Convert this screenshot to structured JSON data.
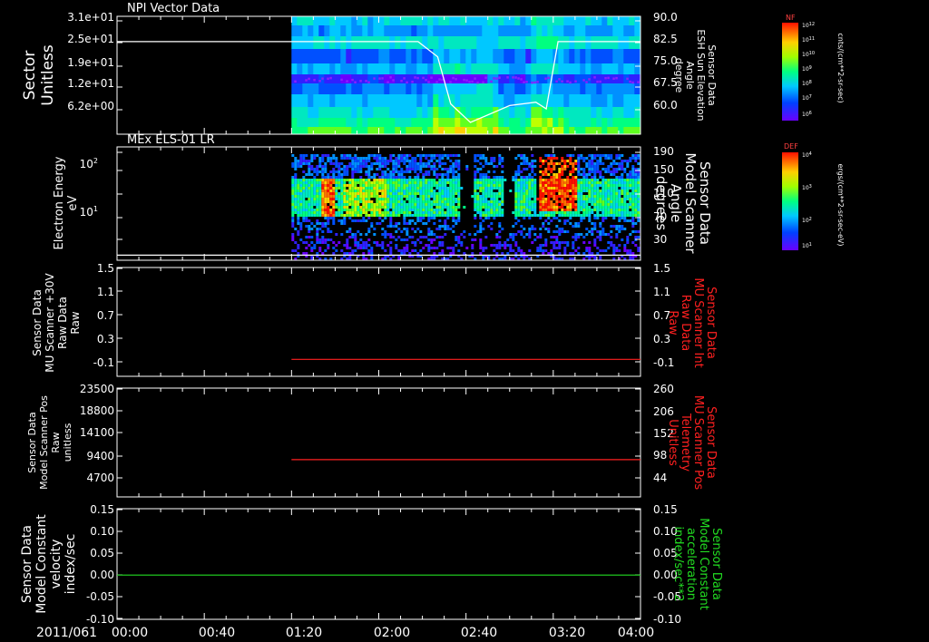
{
  "time_axis": {
    "date": "2011/061",
    "ticks": [
      "00:00",
      "00:40",
      "01:20",
      "02:00",
      "02:40",
      "03:20",
      "04:00"
    ]
  },
  "colors": {
    "background": "#000000",
    "frame": "#ffffff",
    "red_trace": "#ff2020",
    "green_trace": "#22dd22"
  },
  "chart_data": [
    {
      "type": "heatmap",
      "title": "NPI Vector Data",
      "ylabel_left": [
        "Sector",
        "Unitless"
      ],
      "yticks_left": [
        "3.1e+01",
        "2.5e+01",
        "1.9e+01",
        "1.2e+01",
        "6.2e+00"
      ],
      "ylabel_right": [
        "Sensor Data",
        "ESH Sun Elevation",
        "Angle",
        "degree"
      ],
      "yticks_right": [
        "90.0",
        "82.5",
        "75.0",
        "67.5",
        "60.0"
      ],
      "ylim_right": [
        55,
        90
      ],
      "data_start": "01:20",
      "colorbar": {
        "title": "NF",
        "label": "cnts/(cm**2-sr-sec)",
        "ticks": [
          "10^12",
          "10^11",
          "10^10",
          "10^9",
          "10^8",
          "10^7",
          "10^6"
        ]
      },
      "overlay_line": {
        "color": "#ffffff",
        "time_hours": [
          0.0,
          2.3,
          2.45,
          2.55,
          2.7,
          3.0,
          3.2,
          3.28,
          3.37,
          3.4,
          4.0
        ],
        "values": [
          82.5,
          82.5,
          78,
          64,
          58.5,
          63.5,
          64.5,
          62.5,
          82.5,
          82.5,
          82.5
        ]
      }
    },
    {
      "type": "heatmap",
      "title": "MEx ELS-01 LR",
      "ylabel_left": [
        "Electron Energy",
        "eV"
      ],
      "yticks_left": [
        "10^2",
        "10^1"
      ],
      "ylabel_right": [
        "Sensor Data",
        "Model Scanner",
        "Angle",
        "degrees"
      ],
      "yticks_right": [
        "190",
        "150",
        "110",
        "70",
        "30"
      ],
      "ylim_right": [
        10,
        190
      ],
      "data_start": "01:20",
      "colorbar": {
        "title": "DEF",
        "label": "ergs/(cm**2-sr-sec-eV)",
        "ticks": [
          "10^4",
          "10^3",
          "10^2",
          "10^1"
        ]
      },
      "overlay_line": {
        "color": "#ffffff",
        "time_hours": [
          0,
          4
        ],
        "values": [
          18,
          18
        ]
      }
    },
    {
      "type": "line",
      "ylabel_left": [
        "Sensor Data",
        "MU Scanner +30V",
        "Raw Data",
        "Raw"
      ],
      "yticks_left": [
        "1.5",
        "1.1",
        "0.7",
        "0.3",
        "-0.1"
      ],
      "ylabel_right": [
        "Sensor Data",
        "MU Scanner Int",
        "Raw Data",
        "Raw"
      ],
      "yticks_right": [
        "1.5",
        "1.1",
        "0.7",
        "0.3",
        "-0.1"
      ],
      "ylim": [
        -0.3,
        1.5
      ],
      "series": [
        {
          "color": "#ff2020",
          "time_hours": [
            1.333,
            4.0
          ],
          "values": [
            -0.02,
            -0.02
          ]
        }
      ]
    },
    {
      "type": "line",
      "ylabel_left": [
        "Sensor Data",
        "Model Scanner Pos",
        "Raw",
        "unitless"
      ],
      "yticks_left": [
        "23500",
        "18800",
        "14100",
        "9400",
        "4700"
      ],
      "ylabel_right": [
        "Sensor Data",
        "MU Scanner Pos",
        "Telemetry",
        "Unitless"
      ],
      "yticks_right": [
        "260",
        "206",
        "152",
        "98",
        "44"
      ],
      "ylim_right": [
        0,
        260
      ],
      "series": [
        {
          "color": "#ff2020",
          "time_hours": [
            1.333,
            4.0
          ],
          "values": [
            89,
            89
          ]
        }
      ]
    },
    {
      "type": "line",
      "ylabel_left": [
        "Sensor Data",
        "Model Constant",
        "velocity",
        "index/sec"
      ],
      "yticks_left": [
        "0.15",
        "0.10",
        "0.05",
        "0.00",
        "-0.05",
        "-0.10"
      ],
      "ylabel_right": [
        "Sensor Data",
        "Model Constant",
        "acceleration",
        "index/sec**2"
      ],
      "yticks_right": [
        "0.15",
        "0.10",
        "0.05",
        "0.00",
        "-0.05",
        "-0.10"
      ],
      "ylim": [
        -0.1,
        0.15
      ],
      "series": [
        {
          "color": "#22dd22",
          "time_hours": [
            0.0,
            4.0
          ],
          "values": [
            0.0,
            0.0
          ]
        }
      ]
    }
  ]
}
